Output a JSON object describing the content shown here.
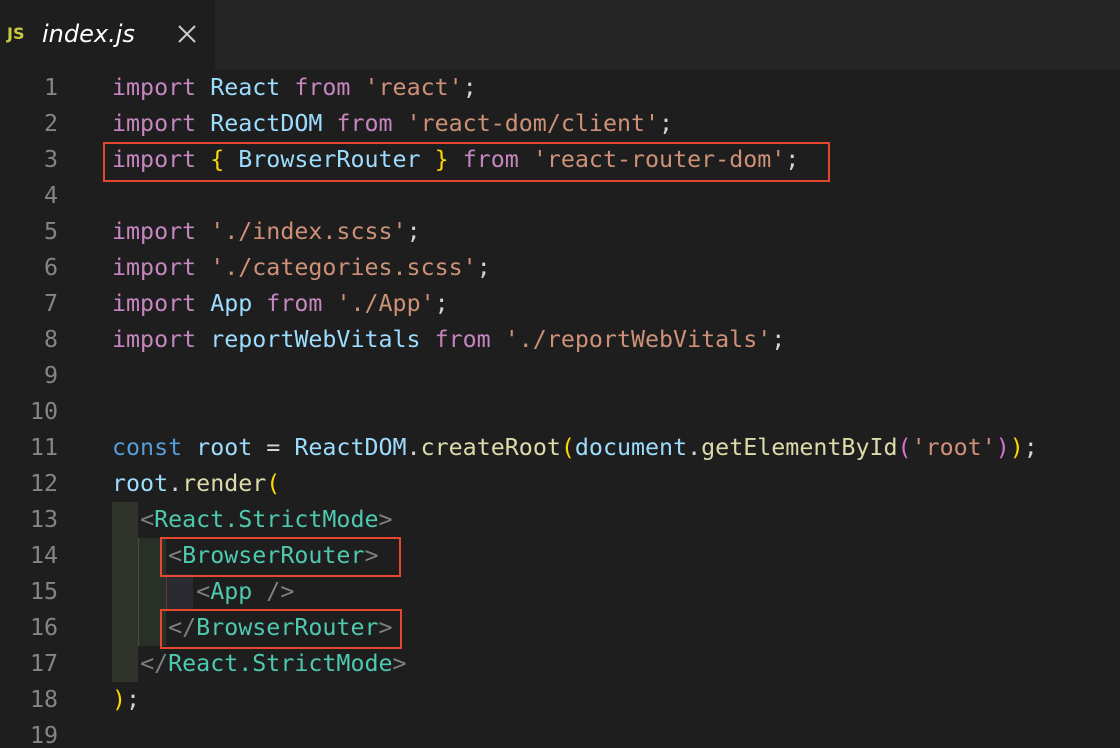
{
  "tab": {
    "icon": "JS",
    "title": "index.js",
    "close_icon": "close-icon"
  },
  "lines": [
    {
      "n": "1",
      "tokens": [
        [
          "kw",
          "import"
        ],
        [
          "punc",
          " "
        ],
        [
          "var",
          "React"
        ],
        [
          "punc",
          " "
        ],
        [
          "kw",
          "from"
        ],
        [
          "punc",
          " "
        ],
        [
          "str",
          "'react'"
        ],
        [
          "punc",
          ";"
        ]
      ]
    },
    {
      "n": "2",
      "tokens": [
        [
          "kw",
          "import"
        ],
        [
          "punc",
          " "
        ],
        [
          "var",
          "ReactDOM"
        ],
        [
          "punc",
          " "
        ],
        [
          "kw",
          "from"
        ],
        [
          "punc",
          " "
        ],
        [
          "str",
          "'react-dom/client'"
        ],
        [
          "punc",
          ";"
        ]
      ]
    },
    {
      "n": "3",
      "tokens": [
        [
          "kw",
          "import"
        ],
        [
          "punc",
          " "
        ],
        [
          "p1",
          "{"
        ],
        [
          "punc",
          " "
        ],
        [
          "var",
          "BrowserRouter"
        ],
        [
          "punc",
          " "
        ],
        [
          "p1",
          "}"
        ],
        [
          "punc",
          " "
        ],
        [
          "kw",
          "from"
        ],
        [
          "punc",
          " "
        ],
        [
          "str",
          "'react-router-dom'"
        ],
        [
          "punc",
          ";"
        ]
      ]
    },
    {
      "n": "4",
      "tokens": []
    },
    {
      "n": "5",
      "tokens": [
        [
          "kw",
          "import"
        ],
        [
          "punc",
          " "
        ],
        [
          "str",
          "'./index.scss'"
        ],
        [
          "punc",
          ";"
        ]
      ]
    },
    {
      "n": "6",
      "tokens": [
        [
          "kw",
          "import"
        ],
        [
          "punc",
          " "
        ],
        [
          "str",
          "'./categories.scss'"
        ],
        [
          "punc",
          ";"
        ]
      ]
    },
    {
      "n": "7",
      "tokens": [
        [
          "kw",
          "import"
        ],
        [
          "punc",
          " "
        ],
        [
          "var",
          "App"
        ],
        [
          "punc",
          " "
        ],
        [
          "kw",
          "from"
        ],
        [
          "punc",
          " "
        ],
        [
          "str",
          "'./App'"
        ],
        [
          "punc",
          ";"
        ]
      ]
    },
    {
      "n": "8",
      "tokens": [
        [
          "kw",
          "import"
        ],
        [
          "punc",
          " "
        ],
        [
          "var",
          "reportWebVitals"
        ],
        [
          "punc",
          " "
        ],
        [
          "kw",
          "from"
        ],
        [
          "punc",
          " "
        ],
        [
          "str",
          "'./reportWebVitals'"
        ],
        [
          "punc",
          ";"
        ]
      ]
    },
    {
      "n": "9",
      "tokens": []
    },
    {
      "n": "10",
      "tokens": []
    },
    {
      "n": "11",
      "tokens": [
        [
          "kwb",
          "const"
        ],
        [
          "punc",
          " "
        ],
        [
          "var",
          "root"
        ],
        [
          "punc",
          " = "
        ],
        [
          "var",
          "ReactDOM"
        ],
        [
          "punc",
          "."
        ],
        [
          "fn",
          "createRoot"
        ],
        [
          "p1",
          "("
        ],
        [
          "var",
          "document"
        ],
        [
          "punc",
          "."
        ],
        [
          "fn",
          "getElementById"
        ],
        [
          "p2",
          "("
        ],
        [
          "str",
          "'root'"
        ],
        [
          "p2",
          ")"
        ],
        [
          "p1",
          ")"
        ],
        [
          "punc",
          ";"
        ]
      ]
    },
    {
      "n": "12",
      "tokens": [
        [
          "var",
          "root"
        ],
        [
          "punc",
          "."
        ],
        [
          "fn",
          "render"
        ],
        [
          "p1",
          "("
        ]
      ]
    },
    {
      "n": "13",
      "tokens": [
        [
          "punc",
          "  "
        ],
        [
          "br",
          "<"
        ],
        [
          "tag",
          "React.StrictMode"
        ],
        [
          "br",
          ">"
        ]
      ]
    },
    {
      "n": "14",
      "tokens": [
        [
          "punc",
          "    "
        ],
        [
          "br",
          "<"
        ],
        [
          "tag",
          "BrowserRouter"
        ],
        [
          "br",
          ">"
        ]
      ]
    },
    {
      "n": "15",
      "tokens": [
        [
          "punc",
          "      "
        ],
        [
          "br",
          "<"
        ],
        [
          "tag",
          "App"
        ],
        [
          "punc",
          " "
        ],
        [
          "br",
          "/>"
        ]
      ]
    },
    {
      "n": "16",
      "tokens": [
        [
          "punc",
          "    "
        ],
        [
          "br",
          "</"
        ],
        [
          "tag",
          "BrowserRouter"
        ],
        [
          "br",
          ">"
        ]
      ]
    },
    {
      "n": "17",
      "tokens": [
        [
          "punc",
          "  "
        ],
        [
          "br",
          "</"
        ],
        [
          "tag",
          "React.StrictMode"
        ],
        [
          "br",
          ">"
        ]
      ]
    },
    {
      "n": "18",
      "tokens": [
        [
          "p1",
          ")"
        ],
        [
          "punc",
          ";"
        ]
      ]
    },
    {
      "n": "19",
      "tokens": []
    }
  ],
  "highlight_color": "#e8472f"
}
